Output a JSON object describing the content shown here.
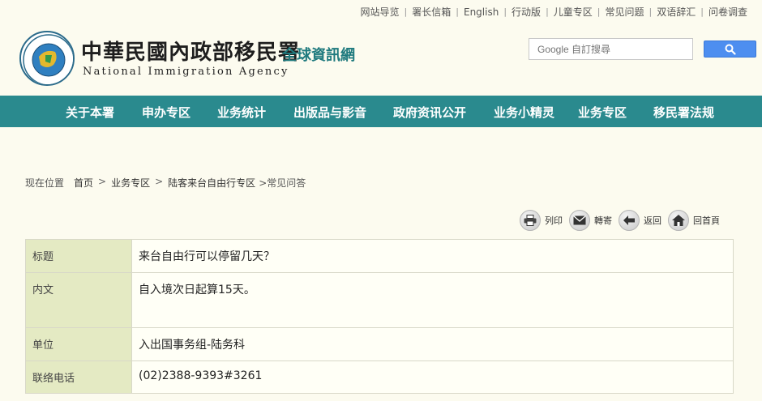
{
  "top_links": [
    "网站导览",
    "署长信箱",
    "English",
    "行动版",
    "儿童专区",
    "常见问题",
    "双语辞汇",
    "问卷调查"
  ],
  "header": {
    "title_cn": "中華民國內政部移民署",
    "title_sub": "全球資訊網",
    "title_en": "National Immigration Agency",
    "search_placeholder": "Google 自訂搜尋",
    "accent": "#2a8a8e"
  },
  "nav": [
    "关于本署",
    "申办专区",
    "业务统计",
    "出版品与影音",
    "政府资讯公开",
    "业务小精灵",
    "业务专区",
    "移民署法规"
  ],
  "breadcrumb": {
    "label": "现在位置",
    "items": [
      "首页",
      "业务专区",
      "陆客来台自由行专区"
    ],
    "current": ">常见问答"
  },
  "tools": [
    {
      "label": "列印",
      "icon": "printer-icon"
    },
    {
      "label": "轉寄",
      "icon": "mail-icon"
    },
    {
      "label": "返回",
      "icon": "back-arrow-icon"
    },
    {
      "label": "回首頁",
      "icon": "home-icon"
    }
  ],
  "detail": {
    "rows": [
      {
        "label": "标题",
        "value": "来台自由行可以停留几天？"
      },
      {
        "label": "内文",
        "value": "自入境次日起算15天。"
      },
      {
        "label": "单位",
        "value": "入出国事务组-陆务科"
      },
      {
        "label": "联络电话",
        "value": "(02)2388-9393#3261"
      }
    ]
  }
}
